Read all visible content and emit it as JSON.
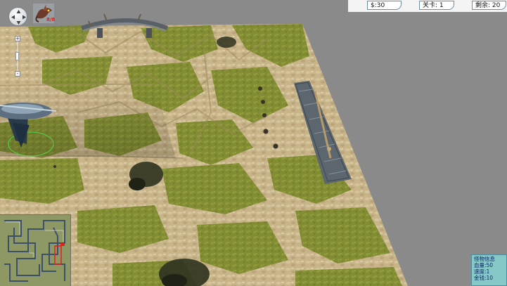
{
  "hud": {
    "money": "$:30",
    "level": "关卡: 1",
    "remaining": "剩余: 20"
  },
  "nav": {
    "zoom_in_label": "+",
    "zoom_out_label": "-"
  },
  "portrait": {
    "count": "8/8"
  },
  "monster_info": {
    "title": "怪物信息",
    "hp": "血量:50",
    "speed": "速度:1",
    "gold": "金钱:10"
  },
  "colors": {
    "background": "#8a8a8a",
    "grass": "#7f8a2c",
    "sand": "#c9b58a",
    "info_box": "#86c8c8",
    "hud_border": "#6b8fa8"
  },
  "icons": {
    "dpad": "navigation-dpad-icon",
    "portrait": "dragon-unit-icon"
  }
}
